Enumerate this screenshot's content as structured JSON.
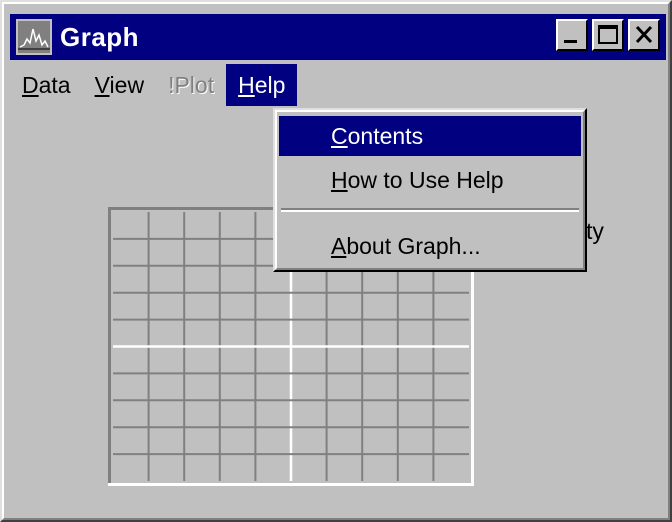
{
  "window": {
    "title": "Graph"
  },
  "menubar": {
    "items": [
      {
        "mnemonic": "D",
        "rest": "ata",
        "state": "normal"
      },
      {
        "mnemonic": "V",
        "rest": "iew",
        "state": "normal"
      },
      {
        "mnemonic": "",
        "rest": "!Plot",
        "state": "disabled"
      },
      {
        "mnemonic": "H",
        "rest": "elp",
        "state": "active"
      }
    ]
  },
  "help_menu": {
    "items": [
      {
        "mnemonic": "C",
        "rest": "ontents",
        "selected": true
      },
      {
        "mnemonic": "H",
        "rest": "ow to Use Help",
        "selected": false
      },
      {
        "mnemonic": "A",
        "rest": "bout Graph...",
        "selected": false
      }
    ]
  },
  "background": {
    "partial_text": "ty"
  },
  "plot": {
    "columns": 10,
    "rows": 10,
    "axis_column": 5,
    "axis_row": 5
  },
  "colors": {
    "titlebar": "#000080",
    "face": "#c0c0c0",
    "selection": "#000080",
    "plot_bg": "#c0c0c0",
    "grid_dark": "#808080",
    "grid_light": "#ffffff"
  },
  "icons": {
    "app": "graph-app-icon",
    "minimize": "minimize-icon",
    "maximize": "maximize-icon",
    "close": "close-icon"
  }
}
